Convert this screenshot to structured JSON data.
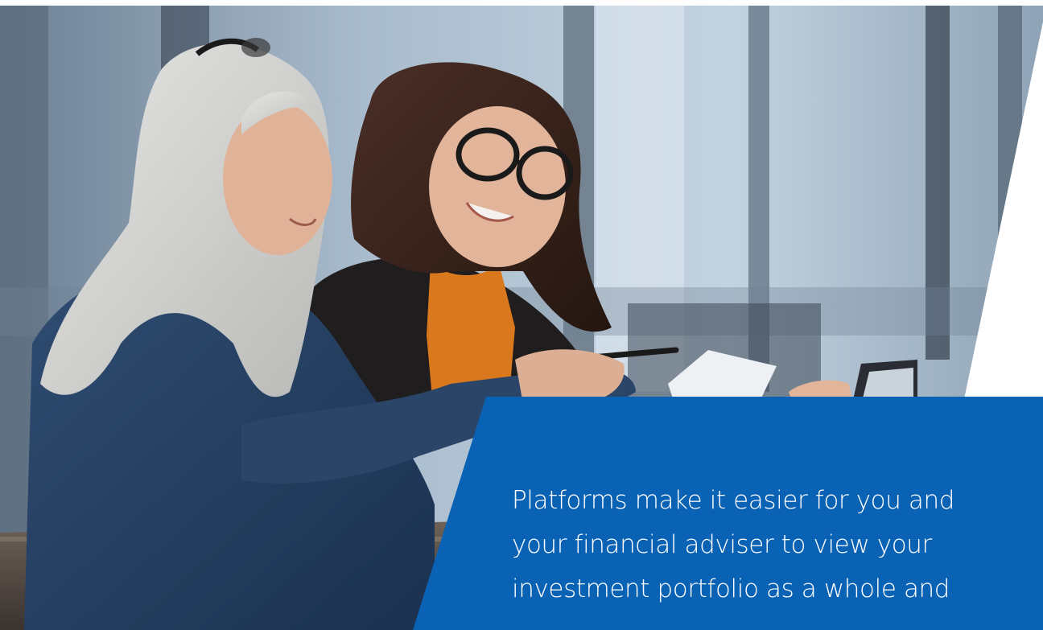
{
  "hero": {
    "image_alt": "Two women reviewing documents at a desk in a bright office"
  },
  "feature_panel": {
    "text": "Platforms make it easier for you and\nyour financial adviser to view your\ninvestment portfolio as a whole and",
    "background_color": "#0a62b4",
    "text_color": "#ffffff"
  }
}
